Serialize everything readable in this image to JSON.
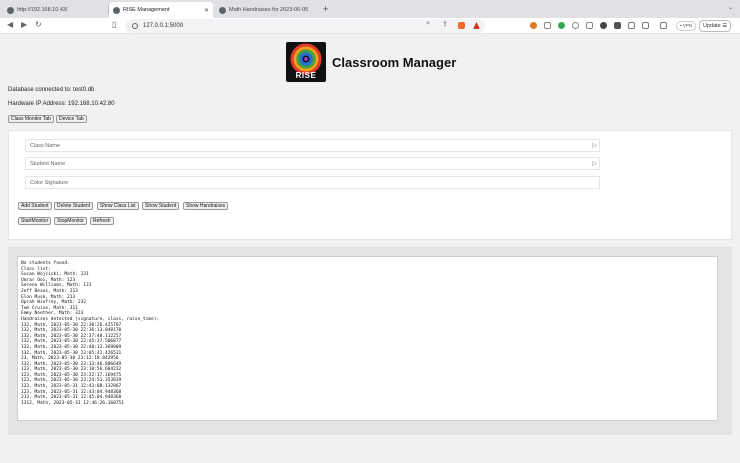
{
  "browser": {
    "tabs": [
      {
        "title": "http://192.168.10.43/",
        "active": false
      },
      {
        "title": "RISE Management",
        "active": true
      },
      {
        "title": "Math Handraises for 2023-06-05",
        "active": false
      }
    ],
    "new_tab": "+",
    "url": "127.0.0.1:5000",
    "vpn_label": "• VPN",
    "update_label": "Update"
  },
  "header": {
    "logo_text": "RISE",
    "title": "Classroom Manager"
  },
  "info": {
    "database": "Database connected to: test0.db",
    "hardware_ip": "Hardware IP Address: 192.168.10.42.80"
  },
  "tabs_buttons": {
    "class_monitor": "Class Monitor Tab",
    "device": "Device Tab"
  },
  "form": {
    "class_name_placeholder": "Class Name",
    "student_name_placeholder": "Student Name",
    "color_signature_placeholder": "Color Signature"
  },
  "actions": {
    "add_student": "Add Student",
    "delete_student": "Delete Student",
    "show_class_list": "Show Class List",
    "show_student": "Show Student",
    "show_handraises": "Show Handraises",
    "start_monitor": "StartMonitor",
    "stop_monitor": "StopMonitor",
    "refresh": "Refresh"
  },
  "output_lines": [
    "No students found.",
    "Class list:",
    "Susan Wojcicki, Math: 131",
    "Umrar Ooi, Math: 123",
    "Serena Williams, Math: 131",
    "Jeff Bezos, Math: 213",
    "Elon Musk, Math: 213",
    "Oprah Winfrey, Math: 232",
    "Tom Cruise, Math: 311",
    "Emmy Noether, Math: 323",
    "Handraises detected (signature, class, raise_time):",
    "132, Math, 2023-05-30 22:30:26.425707",
    "132, Math, 2023-05-30 22:36:13.048170",
    "132, Math, 2023-05-30 22:37:48.112257",
    "132, Math, 2023-05-30 22:45:37.506877",
    "132, Math, 2023-05-30 22:48:12.369009",
    "132, Math, 2023-05-30 23:05:41.426531",
    "23, Math, 2023-05-30 23:12:18.842956",
    "132, Math, 2023-05-30 23:13:46.806649",
    "123, Math, 2023-05-30 23:18:56.684232",
    "123, Math, 2023-05-30 23:22:17.169475",
    "123, Math, 2023-05-30 23:24:51.353839",
    "123, Math, 2023-05-31 12:43:08.132867",
    "123, Math, 2023-05-31 12:43:04.948368",
    "213, Math, 2023-05-31 12:45:04.948368",
    "1312, Math, 2023-05-31 12:46:26.168751"
  ]
}
